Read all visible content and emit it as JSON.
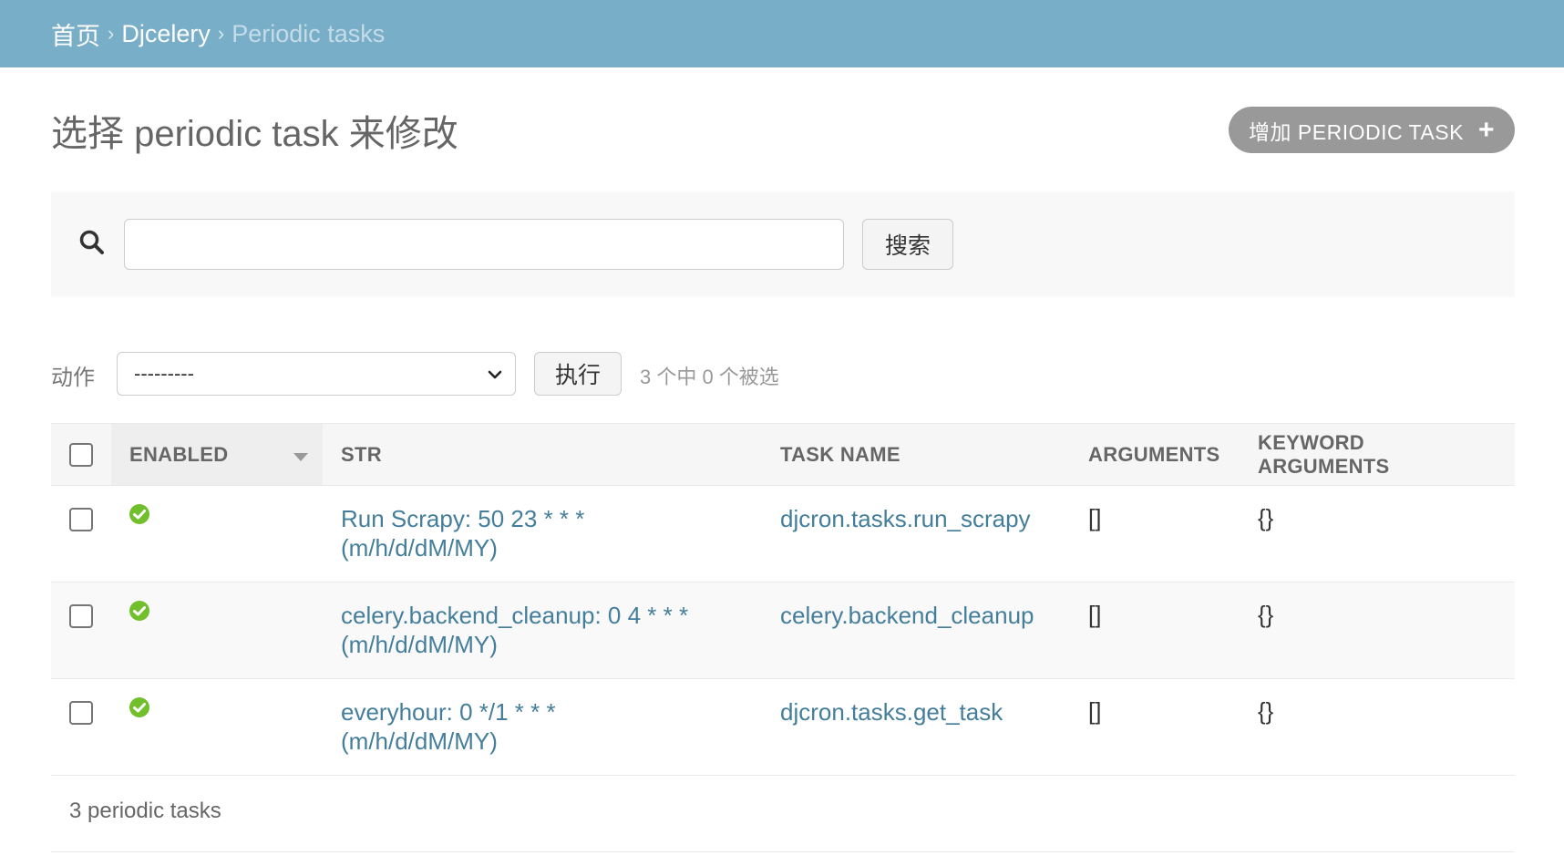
{
  "breadcrumbs": {
    "home": "首页",
    "app": "Djcelery",
    "current": "Periodic tasks",
    "separator": "›"
  },
  "page": {
    "title": "选择 periodic task 来修改",
    "add_button": "增加 PERIODIC TASK"
  },
  "search": {
    "value": "",
    "button": "搜索"
  },
  "actions": {
    "label": "动作",
    "selected_option": "---------",
    "run_button": "执行",
    "selection_count": "3 个中 0 个被选"
  },
  "table": {
    "columns": [
      "ENABLED",
      "STR",
      "TASK NAME",
      "ARGUMENTS",
      "KEYWORD ARGUMENTS"
    ],
    "sorted_column": "ENABLED",
    "rows": [
      {
        "enabled": true,
        "str_line1": "Run Scrapy: 50 23 * * *",
        "str_line2": "(m/h/d/dM/MY)",
        "task_name": "djcron.tasks.run_scrapy",
        "arguments": "[]",
        "kwargs": "{}"
      },
      {
        "enabled": true,
        "str_line1": "celery.backend_cleanup: 0 4 * * *",
        "str_line2": "(m/h/d/dM/MY)",
        "task_name": "celery.backend_cleanup",
        "arguments": "[]",
        "kwargs": "{}"
      },
      {
        "enabled": true,
        "str_line1": "everyhour: 0 */1 * * *",
        "str_line2": "(m/h/d/dM/MY)",
        "task_name": "djcron.tasks.get_task",
        "arguments": "[]",
        "kwargs": "{}"
      }
    ]
  },
  "paginator": "3 periodic tasks",
  "colors": {
    "header_bg": "#79aec8",
    "link": "#447e9b",
    "enabled_ok": "#70bf2b",
    "add_button_bg": "#999999"
  }
}
